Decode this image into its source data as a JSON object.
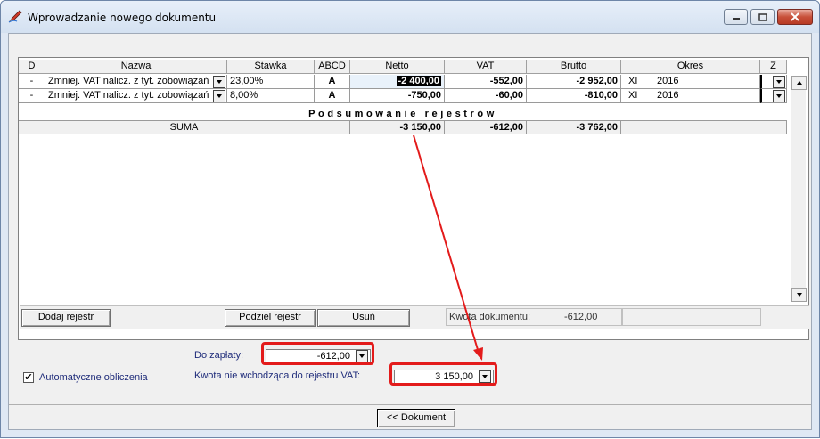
{
  "window": {
    "title": "Wprowadzanie nowego dokumentu"
  },
  "table": {
    "headers": {
      "d": "D",
      "nazwa": "Nazwa",
      "stawka": "Stawka",
      "abcd": "ABCD",
      "netto": "Netto",
      "vat": "VAT",
      "brutto": "Brutto",
      "okres": "Okres",
      "z": "Z"
    },
    "rows": [
      {
        "d": "-",
        "nazwa": "Zmniej. VAT nalicz. z tyt. zobowiązań",
        "stawka": "23,00%",
        "abcd": "A",
        "netto": "-2 400,00",
        "vat": "-552,00",
        "brutto": "-2 952,00",
        "okres_m": "XI",
        "okres_y": "2016"
      },
      {
        "d": "-",
        "nazwa": "Zmniej. VAT nalicz. z tyt. zobowiązań",
        "stawka": "8,00%",
        "abcd": "A",
        "netto": "-750,00",
        "vat": "-60,00",
        "brutto": "-810,00",
        "okres_m": "XI",
        "okres_y": "2016"
      }
    ],
    "summary_title": "Podsumowanie rejestrów",
    "suma": {
      "label": "SUMA",
      "netto": "-3 150,00",
      "vat": "-612,00",
      "brutto": "-3 762,00"
    }
  },
  "footer": {
    "add_register": "Dodaj rejestr",
    "split_register": "Podziel rejestr",
    "remove": "Usuń",
    "doc_amount_label": "Kwota dokumentu:",
    "doc_amount_value": "-612,00"
  },
  "form": {
    "to_pay_label": "Do zapłaty:",
    "to_pay_value": "-612,00",
    "not_vat_label": "Kwota nie wchodząca do rejestru VAT:",
    "not_vat_value": "3 150,00",
    "auto_calc_label": "Automatyczne obliczenia",
    "auto_calc_checked": "✔"
  },
  "bottom": {
    "back_button": "<< Dokument"
  },
  "colors": {
    "highlight": "#e31b1b",
    "selected_cell": "#000000"
  }
}
